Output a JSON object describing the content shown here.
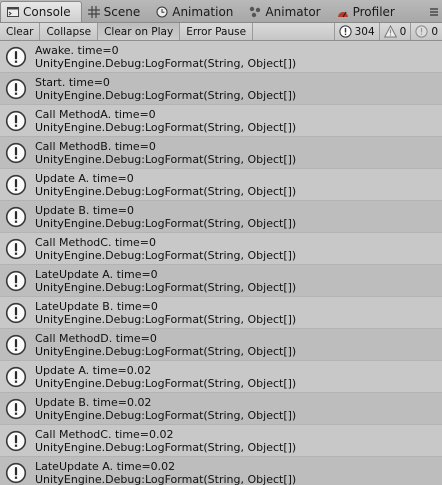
{
  "tabs": [
    {
      "label": "Console",
      "icon": "console-icon",
      "active": true
    },
    {
      "label": "Scene",
      "icon": "grid-icon",
      "active": false
    },
    {
      "label": "Animation",
      "icon": "clock-icon",
      "active": false
    },
    {
      "label": "Animator",
      "icon": "animator-icon",
      "active": false
    },
    {
      "label": "Profiler",
      "icon": "profiler-icon",
      "active": false
    }
  ],
  "toolbar": {
    "clear_label": "Clear",
    "collapse_label": "Collapse",
    "clear_on_play_label": "Clear on Play",
    "error_pause_label": "Error Pause",
    "log_count": "304",
    "warning_count": "0",
    "error_count": "0"
  },
  "logs": [
    {
      "message": "Awake. time=0",
      "source": "UnityEngine.Debug:LogFormat(String, Object[])"
    },
    {
      "message": "Start. time=0",
      "source": "UnityEngine.Debug:LogFormat(String, Object[])"
    },
    {
      "message": "Call MethodA. time=0",
      "source": "UnityEngine.Debug:LogFormat(String, Object[])"
    },
    {
      "message": "Call MethodB. time=0",
      "source": "UnityEngine.Debug:LogFormat(String, Object[])"
    },
    {
      "message": "Update A. time=0",
      "source": "UnityEngine.Debug:LogFormat(String, Object[])"
    },
    {
      "message": "Update B. time=0",
      "source": "UnityEngine.Debug:LogFormat(String, Object[])"
    },
    {
      "message": "Call MethodC. time=0",
      "source": "UnityEngine.Debug:LogFormat(String, Object[])"
    },
    {
      "message": "LateUpdate A. time=0",
      "source": "UnityEngine.Debug:LogFormat(String, Object[])"
    },
    {
      "message": "LateUpdate B. time=0",
      "source": "UnityEngine.Debug:LogFormat(String, Object[])"
    },
    {
      "message": "Call MethodD. time=0",
      "source": "UnityEngine.Debug:LogFormat(String, Object[])"
    },
    {
      "message": "Update A. time=0.02",
      "source": "UnityEngine.Debug:LogFormat(String, Object[])"
    },
    {
      "message": "Update B. time=0.02",
      "source": "UnityEngine.Debug:LogFormat(String, Object[])"
    },
    {
      "message": "Call MethodC. time=0.02",
      "source": "UnityEngine.Debug:LogFormat(String, Object[])"
    },
    {
      "message": "LateUpdate A. time=0.02",
      "source": "UnityEngine.Debug:LogFormat(String, Object[])"
    }
  ]
}
